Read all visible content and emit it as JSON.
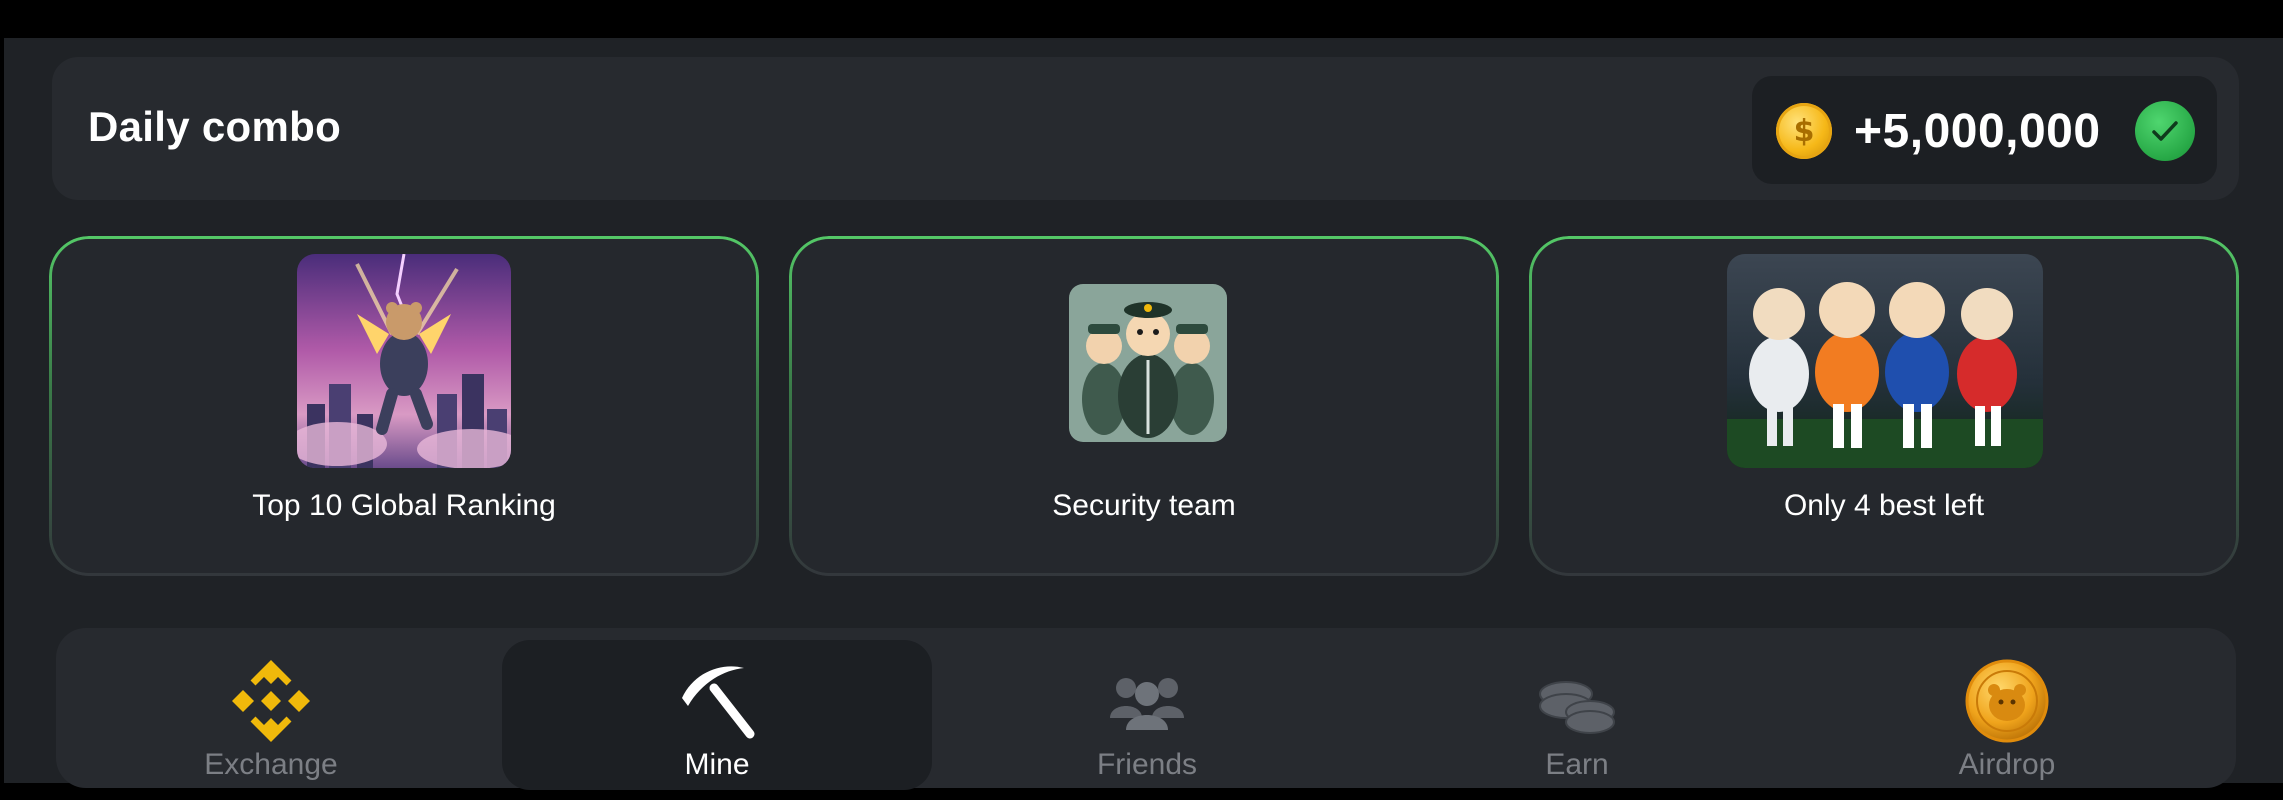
{
  "combo": {
    "title": "Daily combo",
    "reward": "+5,000,000",
    "coin_symbol": "$",
    "status_icon": "check-icon"
  },
  "cards": [
    {
      "label": "Top 10 Global Ranking",
      "image": "hamster-astronaut-image"
    },
    {
      "label": "Security team",
      "image": "hamster-security-team-image"
    },
    {
      "label": "Only 4 best left",
      "image": "hamster-football-players-image"
    }
  ],
  "nav": {
    "active": "Mine",
    "items": [
      {
        "label": "Exchange",
        "icon": "binance-icon"
      },
      {
        "label": "Mine",
        "icon": "pickaxe-icon"
      },
      {
        "label": "Friends",
        "icon": "friends-icon"
      },
      {
        "label": "Earn",
        "icon": "coins-icon"
      },
      {
        "label": "Airdrop",
        "icon": "hamster-coin-icon"
      }
    ]
  },
  "colors": {
    "background": "#1f2226",
    "panel": "#272a2f",
    "accent_green": "#4fbf5e",
    "coin_gold": "#f6b818",
    "binance_yellow": "#f0b90b",
    "inactive_text": "#7c7f85"
  }
}
